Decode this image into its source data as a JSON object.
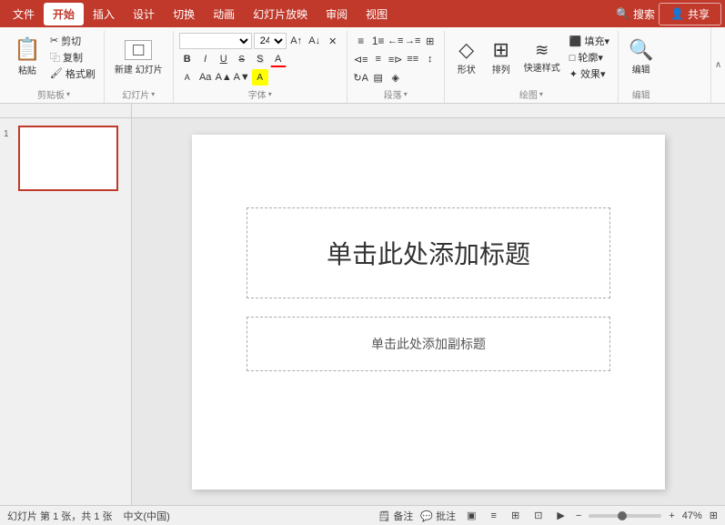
{
  "menu": {
    "items": [
      "文件",
      "开始",
      "插入",
      "设计",
      "切换",
      "动画",
      "幻灯片放映",
      "审阅",
      "视图"
    ],
    "active": "开始",
    "search_label": "搜索",
    "share_label": "共享"
  },
  "ribbon": {
    "groups": [
      {
        "name": "clipboard",
        "label": "剪贴板",
        "buttons": [
          "粘贴",
          "剪切",
          "复制",
          "格式刷"
        ]
      },
      {
        "name": "slides",
        "label": "幻灯片",
        "buttons": [
          "新建\n幻灯片"
        ]
      },
      {
        "name": "font",
        "label": "字体",
        "font_name": "",
        "font_size": "24+"
      },
      {
        "name": "paragraph",
        "label": "段落"
      },
      {
        "name": "drawing",
        "label": "绘图",
        "buttons": [
          "形状",
          "排列",
          "快速样式"
        ]
      },
      {
        "name": "editing",
        "label": "编辑"
      }
    ]
  },
  "slide": {
    "title_placeholder": "单击此处添加标题",
    "subtitle_placeholder": "单击此处添加副标题",
    "number": "1"
  },
  "status": {
    "slide_info": "幻灯片 第 1 张，共 1 张",
    "language": "中文(中国)",
    "notes_label": "备注",
    "comments_label": "批注",
    "zoom_level": "47%",
    "view_normal": "▣",
    "view_outline": "≡",
    "view_slide_sorter": "⊞",
    "view_reading": "⊡",
    "view_slideshow": "▶"
  },
  "icons": {
    "paste": "📋",
    "cut": "✂",
    "copy": "⿻",
    "format_painter": "🖌",
    "new_slide": "□",
    "bold": "B",
    "italic": "I",
    "underline": "U",
    "strikethrough": "S",
    "shadow": "A",
    "font_color": "A",
    "search": "🔍",
    "share": "👤",
    "shape_icon": "◇",
    "arrange_icon": "⊞",
    "quick_style_icon": "≋",
    "editing_icon": "🔍",
    "collapse": "∧",
    "expand_arrow": "▾"
  }
}
